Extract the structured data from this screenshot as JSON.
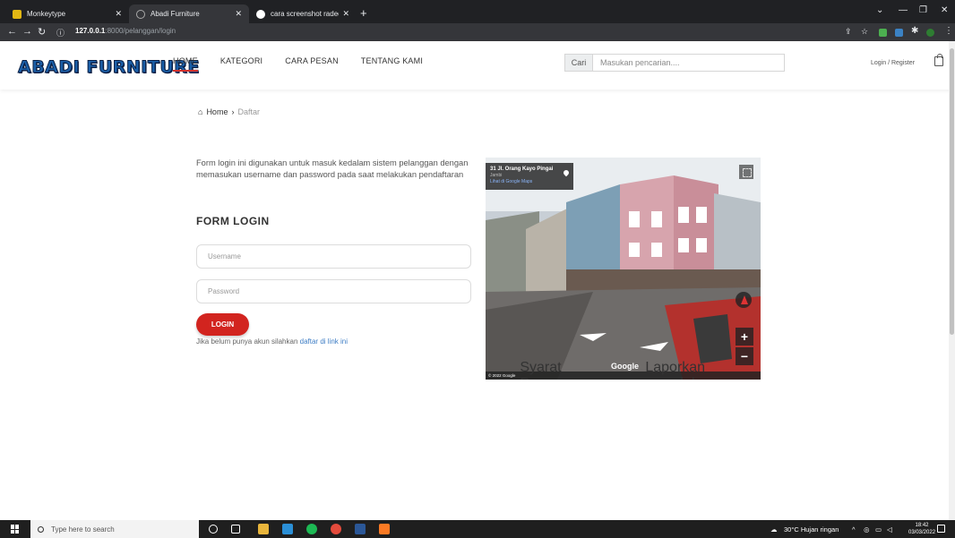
{
  "browser": {
    "tabs": [
      {
        "title": "Monkeytype",
        "active": false
      },
      {
        "title": "Abadi Furniture",
        "active": true
      },
      {
        "title": "cara screenshot radeon software",
        "active": false
      }
    ],
    "url_host": "127.0.0.1",
    "url_path": ":8000/pelanggan/login"
  },
  "site": {
    "logo": "ABADI FURNITURE",
    "menu": [
      {
        "label": "HOME",
        "active": true
      },
      {
        "label": "KATEGORI",
        "active": false
      },
      {
        "label": "CARA PESAN",
        "active": false
      },
      {
        "label": "TENTANG KAMI",
        "active": false
      }
    ],
    "search": {
      "prefix": "Cari",
      "placeholder": "Masukan pencarian...."
    },
    "login_register": "Login / Register"
  },
  "breadcrumb": {
    "home": "Home",
    "separator": "›",
    "current": "Daftar"
  },
  "intro_text": "Form login ini digunakan untuk masuk kedalam sistem pelanggan dengan memasukan username dan password pada saat melakukan pendaftaran",
  "form": {
    "title": "FORM LOGIN",
    "username_placeholder": "Username",
    "password_placeholder": "Password",
    "login_label": "LOGIN",
    "register_prefix": "Jika belum punya akun silahkan",
    "register_link": "daftar di link ini"
  },
  "map": {
    "address": "31 Jl. Orang Kayo Pingai",
    "city": "Jambi",
    "view_link": "Lihat di Google Maps",
    "zoom_in": "+",
    "zoom_out": "−",
    "google": "Google",
    "footer": [
      "© 2022 Google",
      "Syarat Penggunaan",
      "Laporkan masalah"
    ]
  },
  "taskbar": {
    "search_placeholder": "Type here to search",
    "weather": "30°C  Hujan ringan",
    "time": "18:42",
    "date": "03/03/2022"
  },
  "colors": {
    "accent": "#d2241f",
    "logo": "#1b5fa8",
    "link": "#3f7ec5"
  }
}
